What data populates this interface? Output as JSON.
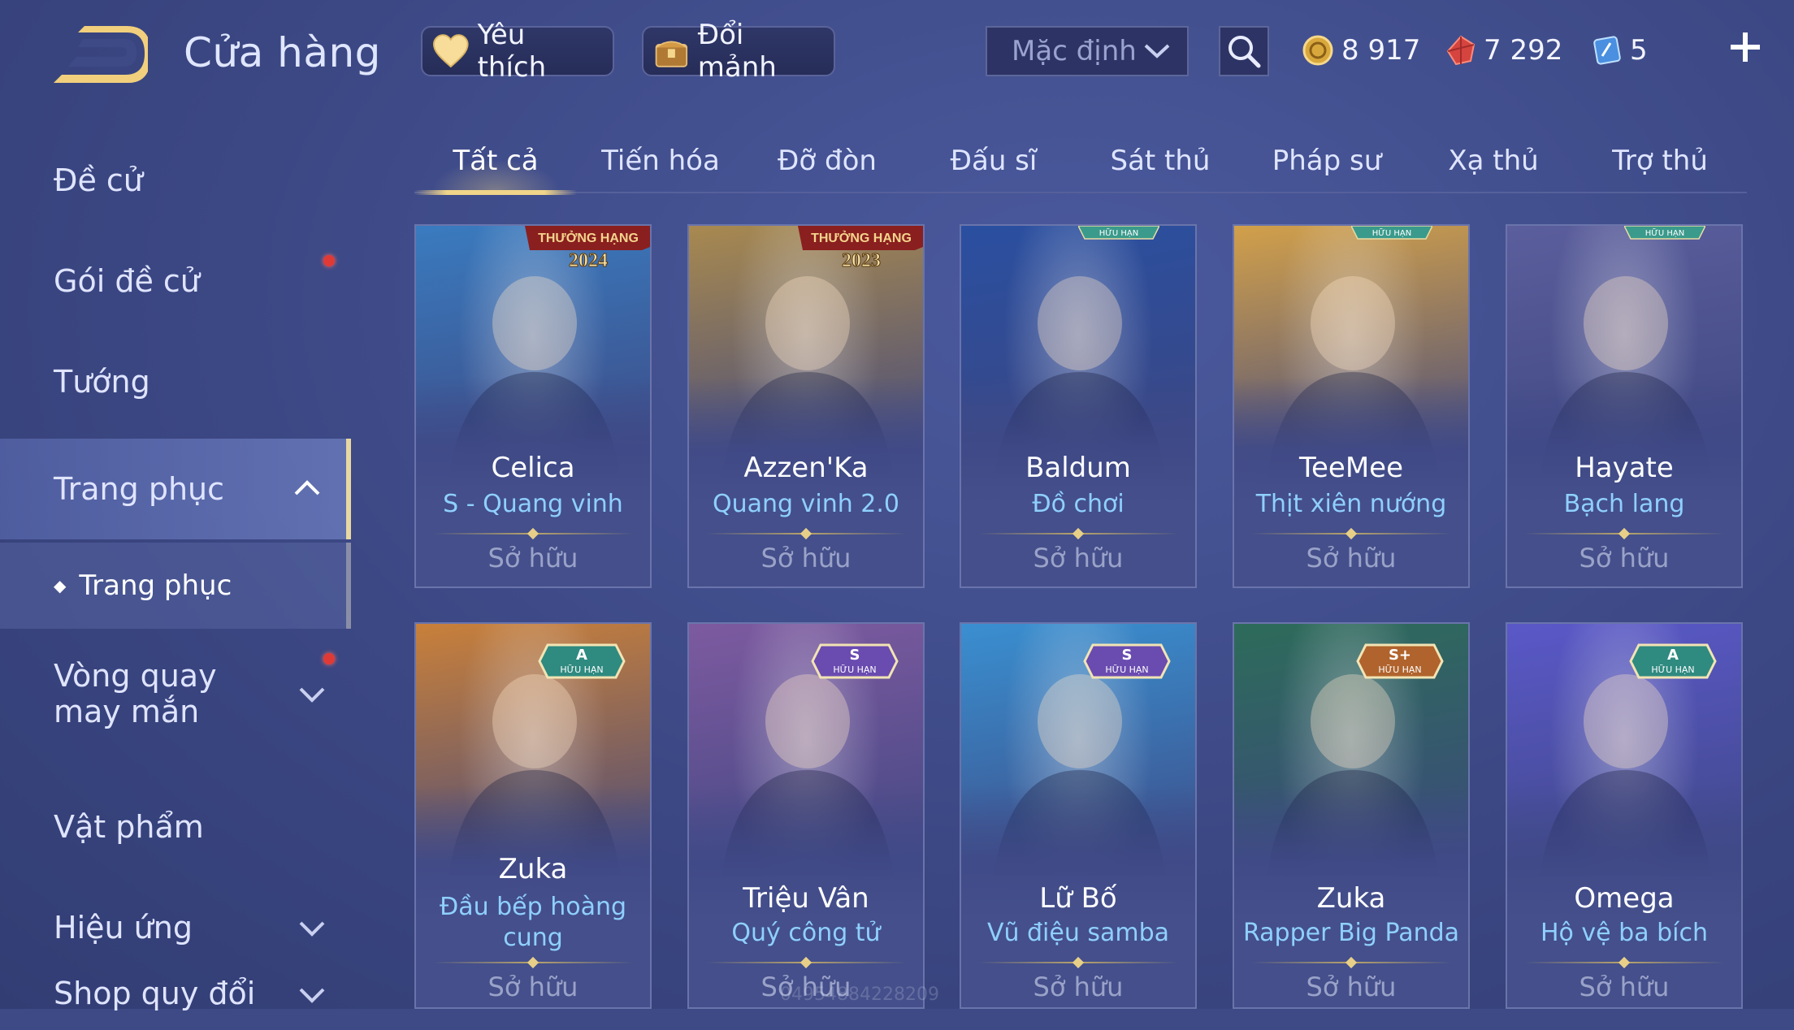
{
  "header": {
    "title": "Cửa hàng",
    "favorites_label": "Yêu thích",
    "exchange_label": "Đổi mảnh",
    "sort_value": "Mặc định"
  },
  "currency": {
    "gold": "8 917",
    "ruby": "7 292",
    "voucher": "5"
  },
  "sidebar": {
    "items": [
      {
        "label": "Đề cử"
      },
      {
        "label": "Gói đề cử"
      },
      {
        "label": "Tướng"
      },
      {
        "label": "Trang phục"
      },
      {
        "label": "Vòng quay may mắn"
      },
      {
        "label": "Vật phẩm"
      },
      {
        "label": "Hiệu ứng"
      },
      {
        "label": "Shop quy đổi"
      }
    ],
    "sub_item": "Trang phục"
  },
  "tabs": [
    {
      "label": "Tất cả",
      "active": true
    },
    {
      "label": "Tiến hóa"
    },
    {
      "label": "Đỡ đòn"
    },
    {
      "label": "Đấu sĩ"
    },
    {
      "label": "Sát thủ"
    },
    {
      "label": "Pháp sư"
    },
    {
      "label": "Xạ thủ"
    },
    {
      "label": "Trợ thủ"
    }
  ],
  "cards": [
    {
      "hero": "Celica",
      "skin": "S - Quang vinh",
      "status": "Sở hữu",
      "ribbon": "THƯỞNG HẠNG",
      "year": "2024",
      "theme": "#3a7bbf"
    },
    {
      "hero": "Azzen'Ka",
      "skin": "Quang vinh 2.0",
      "status": "Sở hữu",
      "ribbon": "THƯỞNG HẠNG",
      "year": "2023",
      "theme": "#a8894f"
    },
    {
      "hero": "Baldum",
      "skin": "Đồ chơi",
      "status": "Sở hữu",
      "limited": "HỮU HẠN",
      "theme": "#2a4fa0"
    },
    {
      "hero": "TeeMee",
      "skin": "Thịt xiên nướng",
      "status": "Sở hữu",
      "limited": "HỮU HẠN",
      "theme": "#d2a04a"
    },
    {
      "hero": "Hayate",
      "skin": "Bạch lang",
      "status": "Sở hữu",
      "limited": "HỮU HẠN",
      "theme": "#5b5e9c"
    },
    {
      "hero": "Zuka",
      "skin": "Đầu bếp hoàng cung",
      "status": "Sở hữu",
      "tier": "A",
      "limited": "HỮU HẠN",
      "theme": "#c9803a"
    },
    {
      "hero": "Triệu Vân",
      "skin": "Quý công tử",
      "status": "Sở hữu",
      "tier": "S",
      "limited": "HỮU HẠN",
      "theme": "#7d5aa0"
    },
    {
      "hero": "Lữ Bố",
      "skin": "Vũ điệu samba",
      "status": "Sở hữu",
      "tier": "S",
      "limited": "HỮU HẠN",
      "theme": "#3a8fd0"
    },
    {
      "hero": "Zuka",
      "skin": "Rapper Big Panda",
      "status": "Sở hữu",
      "tier": "S+",
      "limited": "HỮU HẠN",
      "theme": "#2d6b5a"
    },
    {
      "hero": "Omega",
      "skin": "Hộ vệ ba bích",
      "status": "Sở hữu",
      "tier": "A",
      "limited": "HỮU HẠN",
      "theme": "#5a58c8"
    }
  ],
  "watermark": "04954884228209",
  "colors": {
    "accent_gold": "#f0d58a",
    "skin_blue": "#8fd0ff",
    "background": "#3d4a86"
  }
}
